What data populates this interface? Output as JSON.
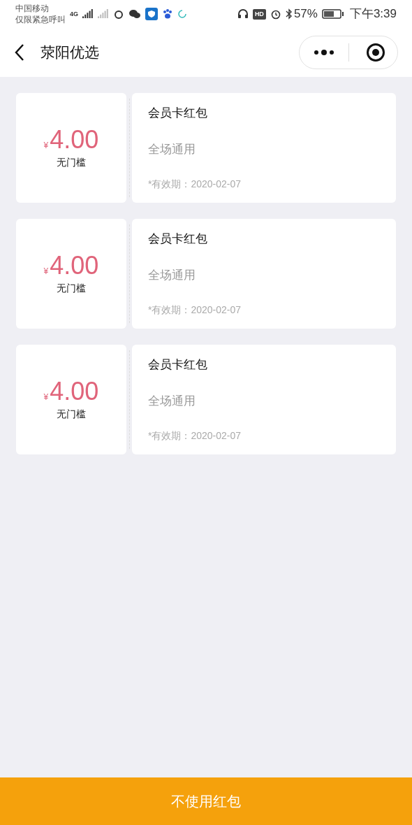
{
  "status_bar": {
    "carrier": "中国移动",
    "carrier_note": "仅限紧急呼叫",
    "network": "4G",
    "hd": "HD",
    "battery": "57%",
    "time": "下午3:39"
  },
  "header": {
    "title": "荥阳优选"
  },
  "coupons": [
    {
      "currency": "¥",
      "amount": "4.00",
      "condition": "无门槛",
      "name": "会员卡红包",
      "scope": "全场通用",
      "validity": "*有效期：2020-02-07"
    },
    {
      "currency": "¥",
      "amount": "4.00",
      "condition": "无门槛",
      "name": "会员卡红包",
      "scope": "全场通用",
      "validity": "*有效期：2020-02-07"
    },
    {
      "currency": "¥",
      "amount": "4.00",
      "condition": "无门槛",
      "name": "会员卡红包",
      "scope": "全场通用",
      "validity": "*有效期：2020-02-07"
    }
  ],
  "footer_button": "不使用红包"
}
